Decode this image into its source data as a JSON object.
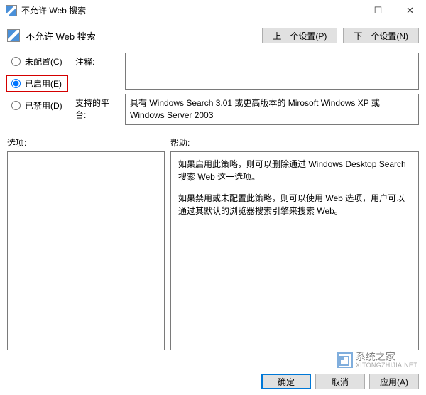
{
  "titlebar": {
    "title": "不允许 Web 搜索"
  },
  "header": {
    "title": "不允许 Web 搜索",
    "prev_button": "上一个设置(P)",
    "next_button": "下一个设置(N)"
  },
  "radios": {
    "not_configured": "未配置(C)",
    "enabled": "已启用(E)",
    "disabled": "已禁用(D)",
    "selected": "enabled"
  },
  "fields": {
    "comment_label": "注释:",
    "comment_value": "",
    "supported_label": "支持的平台:",
    "supported_value": "具有 Windows Search 3.01 或更高版本的 Mirosoft Windows XP 或 Windows Server 2003"
  },
  "panes": {
    "options_label": "选项:",
    "help_label": "帮助:",
    "help_paragraphs": [
      "如果启用此策略，则可以删除通过 Windows Desktop Search 搜索 Web 这一选项。",
      "如果禁用或未配置此策略，则可以使用 Web 选项，用户可以通过其默认的浏览器搜索引擎来搜索 Web。"
    ]
  },
  "buttons": {
    "ok": "确定",
    "cancel": "取消",
    "apply": "应用(A)"
  },
  "watermark": {
    "cn": "系统之家",
    "url": "XITONGZHIJIA.NET"
  }
}
